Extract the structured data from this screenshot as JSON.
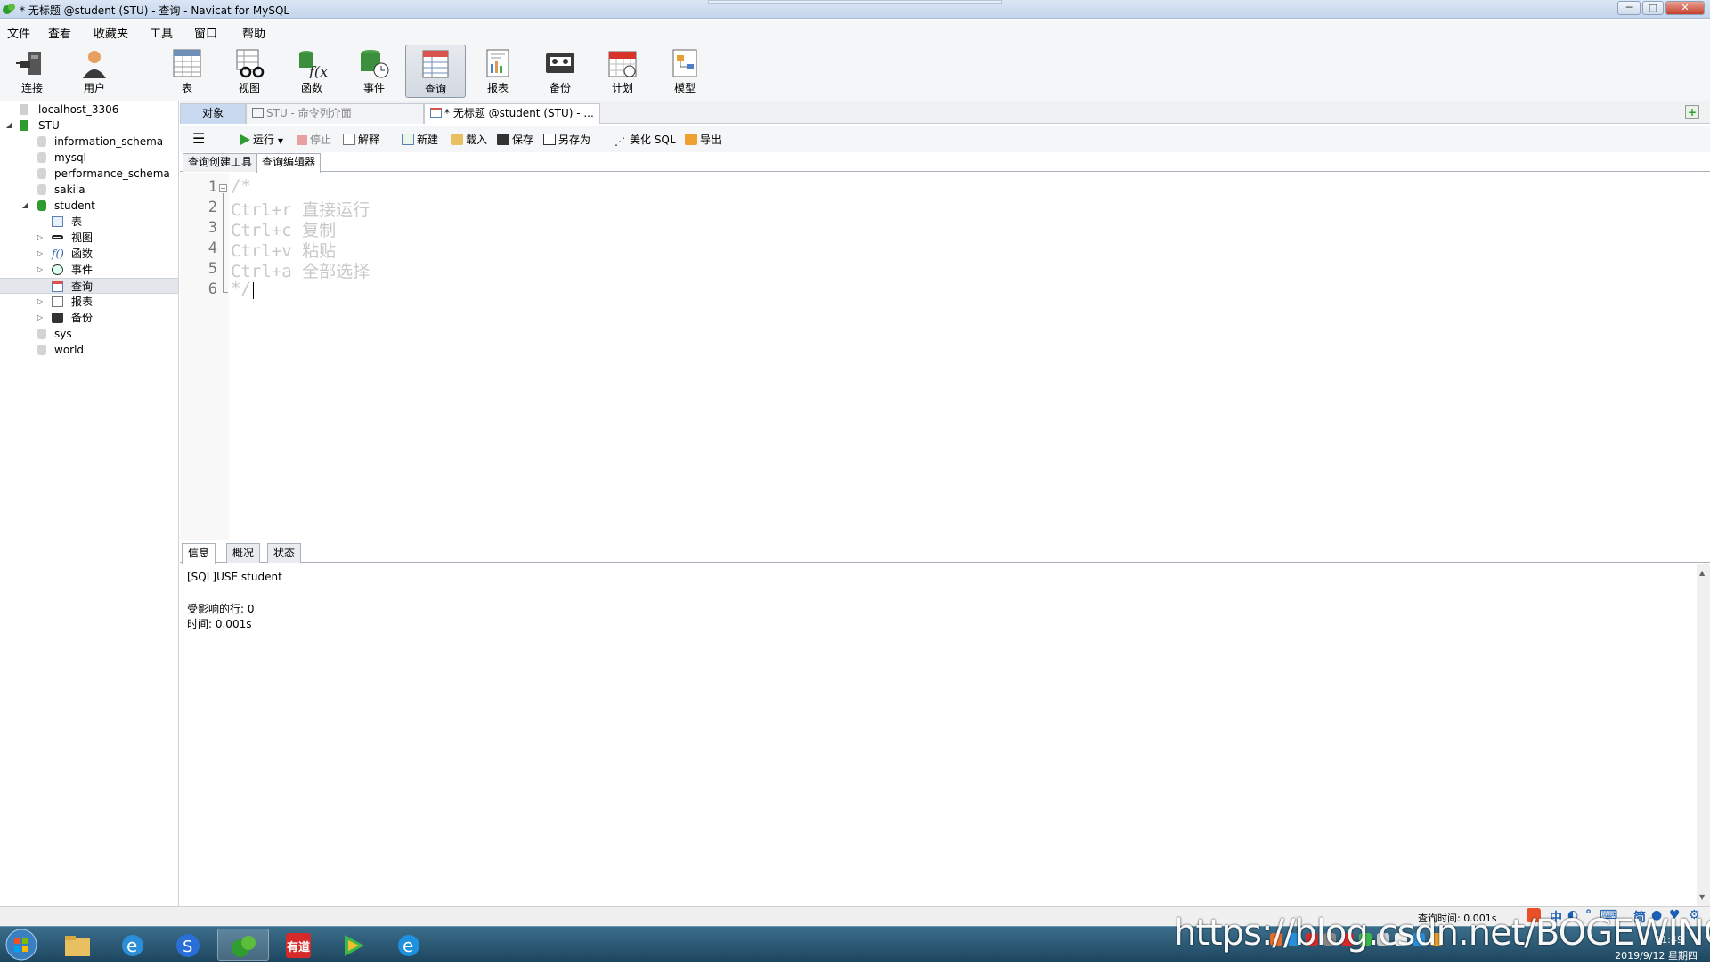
{
  "window": {
    "title": "* 无标题 @student (STU) - 查询 - Navicat for MySQL"
  },
  "menu": [
    "文件",
    "查看",
    "收藏夹",
    "工具",
    "窗口",
    "帮助"
  ],
  "toolbar": {
    "connect": "连接",
    "user": "用户",
    "table": "表",
    "view": "视图",
    "function": "函数",
    "event": "事件",
    "query": "查询",
    "report": "报表",
    "backup": "备份",
    "schedule": "计划",
    "model": "模型"
  },
  "tree": {
    "connection": "localhost_3306",
    "stu": "STU",
    "db1": "information_schema",
    "db2": "mysql",
    "db3": "performance_schema",
    "db4": "sakila",
    "db5": "student",
    "tables": "表",
    "views": "视图",
    "functions": "函数",
    "events": "事件",
    "queries": "查询",
    "reports": "报表",
    "backups": "备份",
    "db6": "sys",
    "db7": "world"
  },
  "tabs": {
    "objects": "对象",
    "cmd": "STU - 命令列介面",
    "current": "* 无标题 @student (STU) - ..."
  },
  "editorToolbar": {
    "run": "运行",
    "stop": "停止",
    "explain": "解释",
    "new": "新建",
    "load": "载入",
    "save": "保存",
    "saveAs": "另存为",
    "beautify": "美化 SQL",
    "export": "导出"
  },
  "subTabs": {
    "builder": "查询创建工具",
    "editor": "查询编辑器"
  },
  "code": {
    "lines": [
      "1",
      "2",
      "3",
      "4",
      "5",
      "6"
    ],
    "l1": "/*",
    "l2": "Ctrl+r 直接运行",
    "l3": "Ctrl+c 复制",
    "l4": "Ctrl+v 粘贴",
    "l5": "Ctrl+a 全部选择",
    "l6": "*/"
  },
  "resultTabs": {
    "info": "信息",
    "overview": "概况",
    "status": "状态"
  },
  "result": {
    "sql": "[SQL]USE student",
    "affected": "受影响的行: 0",
    "time": "时间: 0.001s"
  },
  "status": {
    "queryTime": "查询时间: 0.001s"
  },
  "taskbar": {
    "youdao": "有道",
    "time": "11:49",
    "date": "2019/9/12 星期四"
  },
  "ime": {
    "zh": "中",
    "simp": "简"
  },
  "watermark": "https://blog.csdn.net/BOGEWING",
  "colors": {
    "accent": "#c9daf0",
    "taskbar": "#2b5a77",
    "runGreen": "#2e9c2e"
  }
}
